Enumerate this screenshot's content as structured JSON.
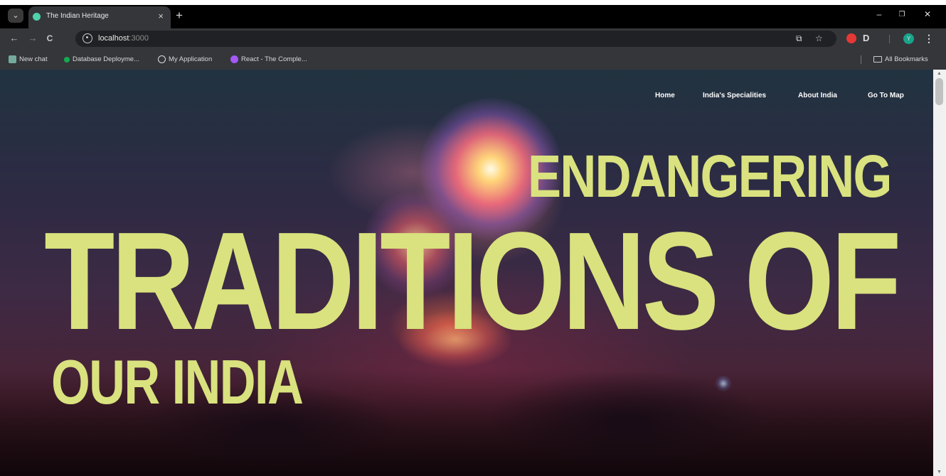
{
  "browser": {
    "tab": {
      "title": "The Indian Heritage",
      "close_glyph": "×",
      "favicon_color": "#4fd3a8"
    },
    "new_tab_glyph": "+",
    "tab_menu_glyph": "⌄",
    "window_controls": {
      "minimize": "–",
      "restore": "❐",
      "close": "✕"
    },
    "nav": {
      "back": "←",
      "forward": "→",
      "reload": "C"
    },
    "address": {
      "host": "localhost",
      "port": ":3000"
    },
    "toolbar_icons": {
      "cast": "⧉",
      "bookmark_star": "☆",
      "extensions": "D",
      "menu": "⋮",
      "profile_initial": "Y"
    },
    "bookmarks": [
      {
        "label": "New chat",
        "icon_color": "#74aa9c"
      },
      {
        "label": "Database Deployme...",
        "icon_color": "#13aa52"
      },
      {
        "label": "My Application",
        "icon_color": "#dddddd"
      },
      {
        "label": "React - The Comple...",
        "icon_color": "#a259f7"
      }
    ],
    "all_bookmarks": "All Bookmarks"
  },
  "site": {
    "nav": [
      "Home",
      "India's Specialities",
      "About India",
      "Go To Map"
    ],
    "headline": {
      "line1": "ENDANGERING",
      "line2": "TRADITIONS OF",
      "line3": "OUR INDIA"
    },
    "headline_color": "#d9e27e"
  },
  "scrollbar": {
    "up": "▲",
    "down": "▼"
  }
}
